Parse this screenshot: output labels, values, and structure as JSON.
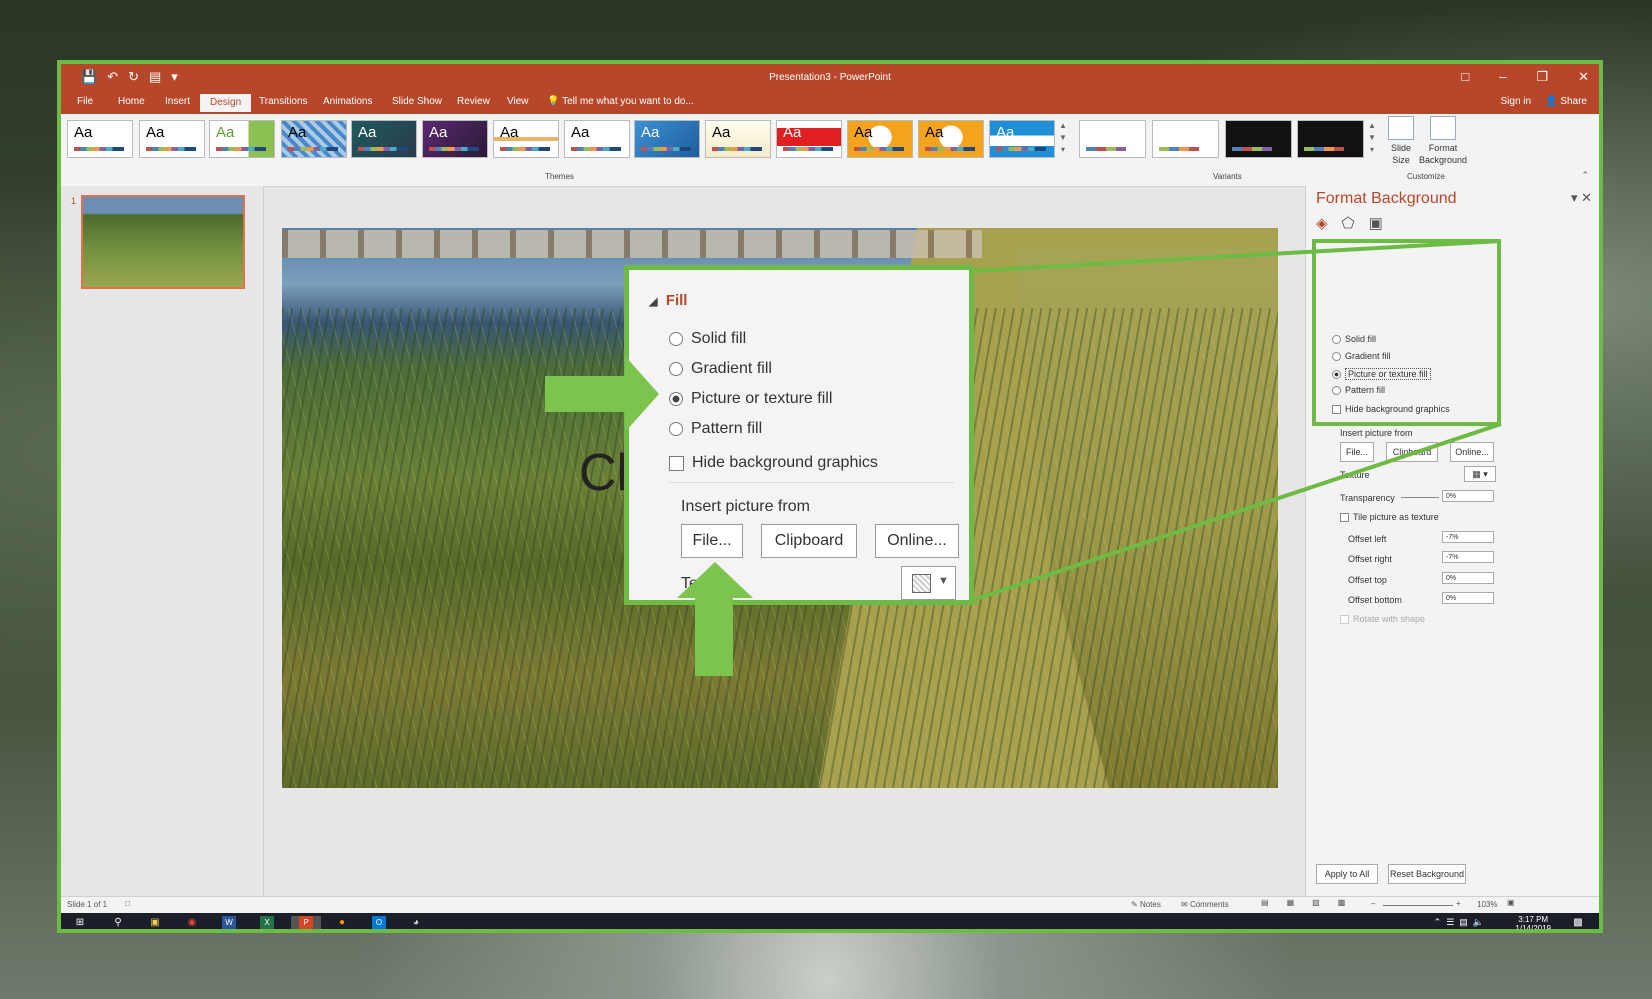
{
  "window": {
    "title": "Presentation3 - PowerPoint",
    "sign_in": "Sign in",
    "share": "Share"
  },
  "tabs": [
    "File",
    "Home",
    "Insert",
    "Design",
    "Transitions",
    "Animations",
    "Slide Show",
    "Review",
    "View"
  ],
  "tell_me": "Tell me what you want to do...",
  "ribbon": {
    "theme_label": "Aa",
    "groups": {
      "themes": "Themes",
      "variants": "Variants",
      "customize": "Customize"
    },
    "customize": {
      "slide_size": "Slide Size",
      "format_background": "Format Background"
    }
  },
  "thumbnail_number": "1",
  "slide_title_fragment": "Cl",
  "format_pane": {
    "title": "Format Background",
    "options": [
      "Solid fill",
      "Gradient fill",
      "Picture or texture fill",
      "Pattern fill"
    ],
    "selected_option": "Picture or texture fill",
    "hide_bg": "Hide background graphics",
    "insert_from": "Insert picture from",
    "buttons": {
      "file": "File...",
      "clipboard": "Clipboard",
      "online": "Online..."
    },
    "texture": "Texture",
    "transparency": "Transparency",
    "transparency_value": "0%",
    "tile": "Tile picture as texture",
    "offsets": [
      {
        "label": "Offset left",
        "value": "-7%"
      },
      {
        "label": "Offset right",
        "value": "-7%"
      },
      {
        "label": "Offset top",
        "value": "0%"
      },
      {
        "label": "Offset bottom",
        "value": "0%"
      }
    ],
    "rotate": "Rotate with shape",
    "apply_all": "Apply to All",
    "reset": "Reset Background"
  },
  "callout": {
    "section": "Fill",
    "options": [
      "Solid fill",
      "Gradient fill",
      "Picture or texture fill",
      "Pattern fill"
    ],
    "hide_bg": "Hide background graphics",
    "insert_from": "Insert picture from",
    "file": "File...",
    "clipboard": "Clipboard",
    "online": "Online...",
    "texture_fragment": "Te"
  },
  "status": {
    "slide_info": "Slide 1 of 1",
    "notes": "Notes",
    "comments": "Comments",
    "zoom": "103%"
  },
  "taskbar": {
    "time": "3:17 PM",
    "date": "1/14/2019"
  },
  "colors": {
    "accent": "#b7472a",
    "callout_green": "#6dbb45"
  }
}
